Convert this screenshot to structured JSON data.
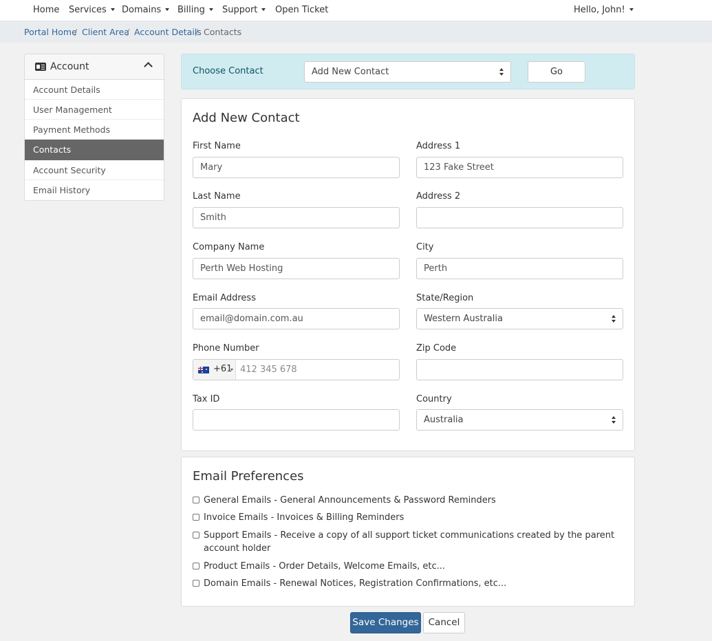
{
  "nav": {
    "home": "Home",
    "services": "Services",
    "domains": "Domains",
    "billing": "Billing",
    "support": "Support",
    "open_ticket": "Open Ticket",
    "user_greeting": "Hello, John!"
  },
  "breadcrumb": {
    "portal_home": "Portal Home",
    "client_area": "Client Area",
    "account_details": "Account Details",
    "current": "Contacts",
    "separator": "/"
  },
  "sidebar": {
    "title": "Account",
    "icon": "id-card-icon",
    "items": [
      {
        "label": "Account Details",
        "active": false
      },
      {
        "label": "User Management",
        "active": false
      },
      {
        "label": "Payment Methods",
        "active": false
      },
      {
        "label": "Contacts",
        "active": true
      },
      {
        "label": "Account Security",
        "active": false
      },
      {
        "label": "Email History",
        "active": false
      }
    ]
  },
  "choose_contact": {
    "label": "Choose Contact",
    "selected": "Add New Contact",
    "go_label": "Go"
  },
  "contact_form": {
    "title": "Add New Contact",
    "first_name": {
      "label": "First Name",
      "value": "Mary"
    },
    "last_name": {
      "label": "Last Name",
      "value": "Smith"
    },
    "company_name": {
      "label": "Company Name",
      "value": "Perth Web Hosting"
    },
    "email": {
      "label": "Email Address",
      "value": "email@domain.com.au"
    },
    "phone": {
      "label": "Phone Number",
      "country_code": "+61",
      "placeholder": "412 345 678"
    },
    "tax_id": {
      "label": "Tax ID",
      "value": ""
    },
    "address1": {
      "label": "Address 1",
      "value": "123 Fake Street"
    },
    "address2": {
      "label": "Address 2",
      "value": ""
    },
    "city": {
      "label": "City",
      "value": "Perth"
    },
    "state": {
      "label": "State/Region",
      "value": "Western Australia"
    },
    "zip": {
      "label": "Zip Code",
      "value": ""
    },
    "country": {
      "label": "Country",
      "value": "Australia"
    }
  },
  "email_preferences": {
    "title": "Email Preferences",
    "items": [
      {
        "label": "General Emails - General Announcements & Password Reminders",
        "checked": false
      },
      {
        "label": "Invoice Emails - Invoices & Billing Reminders",
        "checked": false
      },
      {
        "label": "Support Emails - Receive a copy of all support ticket communications created by the parent account holder",
        "checked": false
      },
      {
        "label": "Product Emails - Order Details, Welcome Emails, etc...",
        "checked": false
      },
      {
        "label": "Domain Emails - Renewal Notices, Registration Confirmations, etc...",
        "checked": false
      }
    ]
  },
  "actions": {
    "save_label": "Save Changes",
    "cancel_label": "Cancel"
  },
  "colors": {
    "primary": "#336699",
    "info_bg": "#d1ecf1",
    "sidebar_active": "#666666"
  }
}
